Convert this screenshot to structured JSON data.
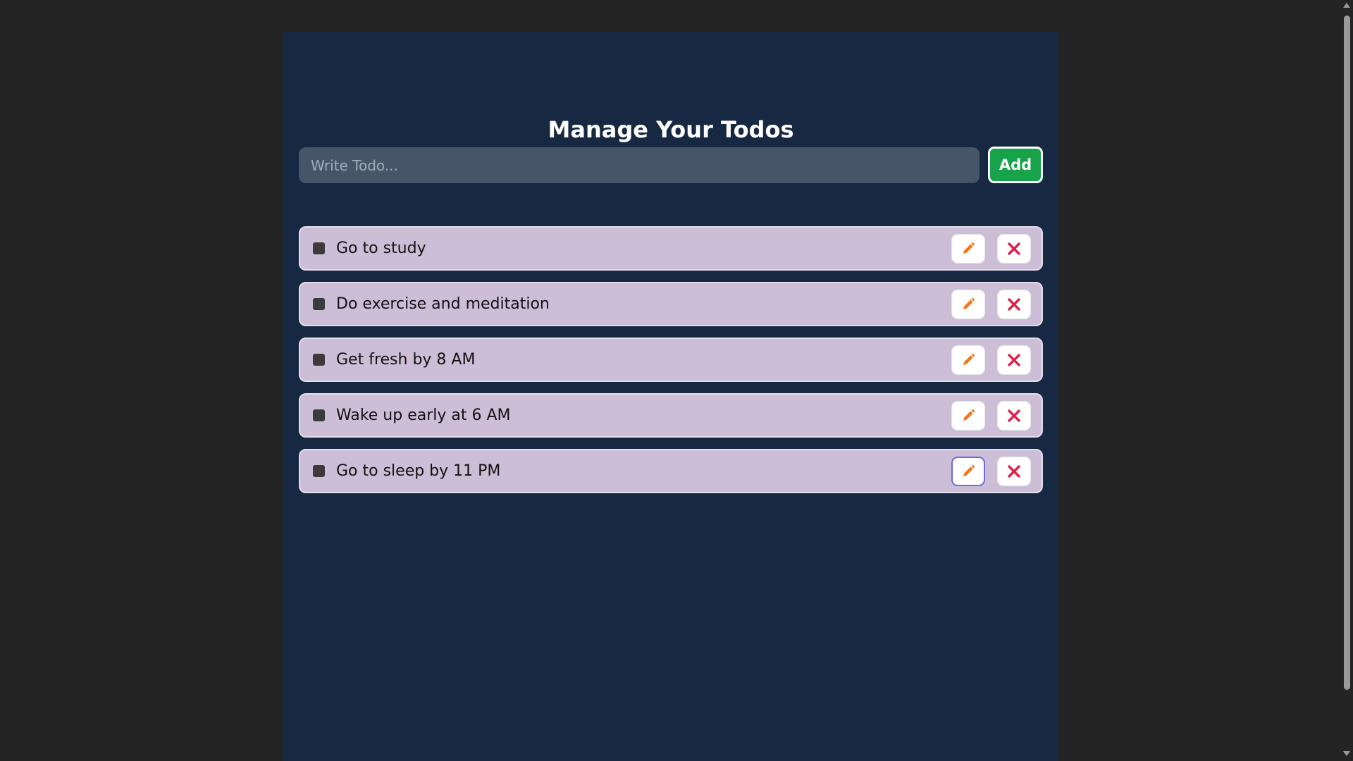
{
  "app": {
    "title": "Manage Your Todos"
  },
  "form": {
    "placeholder": "Write Todo...",
    "value": "",
    "add_label": "Add"
  },
  "todos": [
    {
      "text": "Go to study",
      "completed": false
    },
    {
      "text": "Do exercise and meditation",
      "completed": false
    },
    {
      "text": "Get fresh by 8 AM",
      "completed": false
    },
    {
      "text": "Wake up early at 6 AM",
      "completed": false
    },
    {
      "text": "Go to sleep by 11 PM",
      "completed": false
    }
  ],
  "icons": {
    "edit": "pencil-icon",
    "delete": "close-icon"
  },
  "colors": {
    "page_background": "#242424",
    "panel_background": "#172842",
    "input_background": "#475569",
    "add_button": "#16a34a",
    "todo_background": "#ccbed7",
    "edit_icon": "#f97316",
    "delete_icon": "#e11d48"
  }
}
